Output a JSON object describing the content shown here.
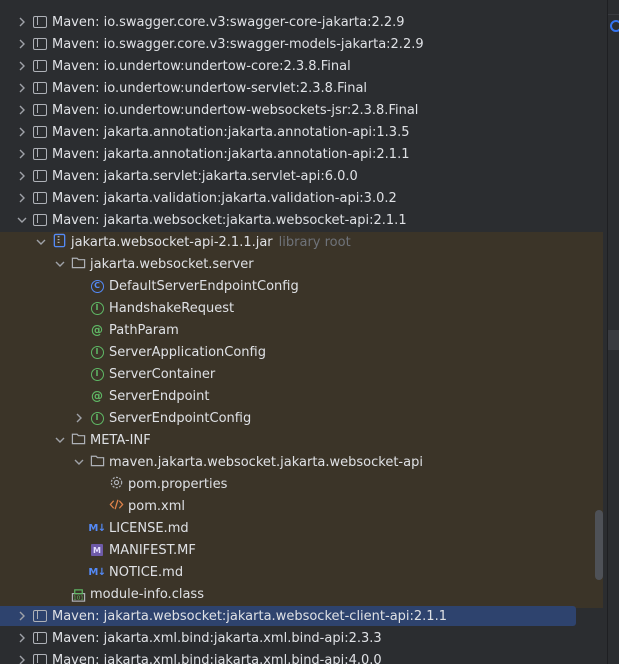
{
  "colors": {
    "background": "#2b2d30",
    "highlight_zone": "#3b3428",
    "selection": "#2e436e",
    "text": "#dfe1e5",
    "muted": "#6f737a",
    "class_icon": "#548af7",
    "interface_icon": "#5fb865",
    "xml_icon": "#e0834a"
  },
  "tree": [
    {
      "label": "Maven: io.swagger.core.v3:swagger-core-jakarta:2.2.9",
      "icon": "library-icon",
      "chevron": "right"
    },
    {
      "label": "Maven: io.swagger.core.v3:swagger-models-jakarta:2.2.9",
      "icon": "library-icon",
      "chevron": "right"
    },
    {
      "label": "Maven: io.undertow:undertow-core:2.3.8.Final",
      "icon": "library-icon",
      "chevron": "right"
    },
    {
      "label": "Maven: io.undertow:undertow-servlet:2.3.8.Final",
      "icon": "library-icon",
      "chevron": "right"
    },
    {
      "label": "Maven: io.undertow:undertow-websockets-jsr:2.3.8.Final",
      "icon": "library-icon",
      "chevron": "right"
    },
    {
      "label": "Maven: jakarta.annotation:jakarta.annotation-api:1.3.5",
      "icon": "library-icon",
      "chevron": "right"
    },
    {
      "label": "Maven: jakarta.annotation:jakarta.annotation-api:2.1.1",
      "icon": "library-icon",
      "chevron": "right"
    },
    {
      "label": "Maven: jakarta.servlet:jakarta.servlet-api:6.0.0",
      "icon": "library-icon",
      "chevron": "right"
    },
    {
      "label": "Maven: jakarta.validation:jakarta.validation-api:3.0.2",
      "icon": "library-icon",
      "chevron": "right"
    },
    {
      "label": "Maven: jakarta.websocket:jakarta.websocket-api:2.1.1",
      "icon": "library-icon",
      "chevron": "down"
    },
    {
      "label": "jakarta.websocket-api-2.1.1.jar",
      "hint": "library root",
      "icon": "jar-icon",
      "chevron": "down"
    },
    {
      "label": "jakarta.websocket.server",
      "icon": "package-folder-icon",
      "chevron": "down"
    },
    {
      "label": "DefaultServerEndpointConfig",
      "icon": "class-icon",
      "badge": "C",
      "chevron": ""
    },
    {
      "label": "HandshakeRequest",
      "icon": "interface-icon",
      "badge": "I",
      "chevron": ""
    },
    {
      "label": "PathParam",
      "icon": "annotation-icon",
      "badge": "@",
      "chevron": ""
    },
    {
      "label": "ServerApplicationConfig",
      "icon": "interface-icon",
      "badge": "I",
      "chevron": ""
    },
    {
      "label": "ServerContainer",
      "icon": "interface-icon",
      "badge": "I",
      "chevron": ""
    },
    {
      "label": "ServerEndpoint",
      "icon": "annotation-icon",
      "badge": "@",
      "chevron": ""
    },
    {
      "label": "ServerEndpointConfig",
      "icon": "interface-icon",
      "badge": "I",
      "chevron": "right"
    },
    {
      "label": "META-INF",
      "icon": "folder-icon",
      "chevron": "down"
    },
    {
      "label": "maven.jakarta.websocket.jakarta.websocket-api",
      "icon": "folder-icon",
      "chevron": "down"
    },
    {
      "label": "pom.properties",
      "icon": "gear-icon",
      "chevron": ""
    },
    {
      "label": "pom.xml",
      "icon": "xml-icon",
      "chevron": ""
    },
    {
      "label": "LICENSE.md",
      "icon": "markdown-icon",
      "badge": "M↓",
      "chevron": ""
    },
    {
      "label": "MANIFEST.MF",
      "icon": "manifest-icon",
      "badge": "M",
      "chevron": ""
    },
    {
      "label": "NOTICE.md",
      "icon": "markdown-icon",
      "badge": "M↓",
      "chevron": ""
    },
    {
      "label": "module-info.class",
      "icon": "module-icon",
      "chevron": ""
    },
    {
      "label": "Maven: jakarta.websocket:jakarta.websocket-client-api:2.1.1",
      "icon": "library-icon",
      "chevron": "right",
      "selected": true
    },
    {
      "label": "Maven: jakarta.xml.bind:jakarta.xml.bind-api:2.3.3",
      "icon": "library-icon",
      "chevron": "right"
    },
    {
      "label": "Maven: jakarta.xml.bind:jakarta.xml.bind-api:4.0.0",
      "icon": "library-icon",
      "chevron": "right"
    }
  ]
}
